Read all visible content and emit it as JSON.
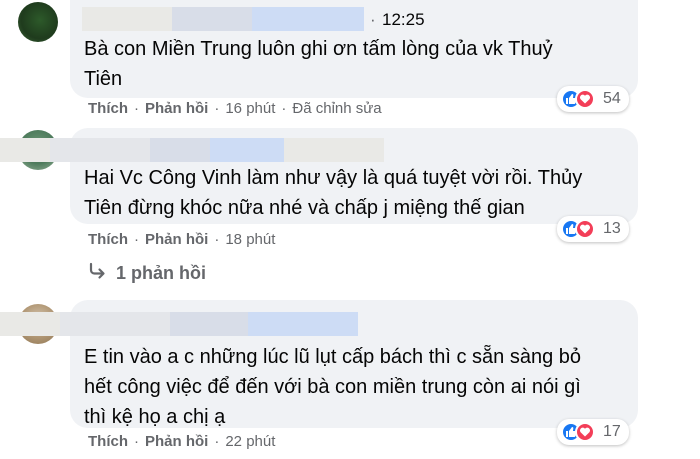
{
  "comments": [
    {
      "time": "12:25",
      "text_lines": [
        "Bà con Miền Trung luôn ghi ơn tấm lòng của vk Thuỷ",
        "Tiên"
      ],
      "like_label": "Thích",
      "reply_label": "Phản hồi",
      "age": "16 phút",
      "edited": "Đã chỉnh sửa",
      "reaction_count": "54"
    },
    {
      "text_lines": [
        "Hai Vc Công Vinh làm như vậy là quá tuyệt vời rồi. Thủy",
        "Tiên đừng khóc nữa nhé và chấp j miệng thế gian"
      ],
      "like_label": "Thích",
      "reply_label": "Phản hồi",
      "age": "18 phút",
      "reaction_count": "13",
      "replies_label": "1 phản hồi"
    },
    {
      "text_lines": [
        "E tin vào a c những lúc lũ lụt cấp bách thì c sẵn sàng bỏ",
        "hết công việc để đến với bà con miền trung còn ai nói gì",
        "thì kệ họ a chị ạ"
      ],
      "like_label": "Thích",
      "reply_label": "Phản hồi",
      "age": "22 phút",
      "reaction_count": "17"
    }
  ],
  "icons": {
    "like": "like-icon",
    "love": "love-icon",
    "reply_arrow": "reply-arrow-icon"
  },
  "colors": {
    "like": "#1877f2",
    "love": "#f33e58",
    "bubble": "#f0f2f5",
    "meta": "#65676b"
  }
}
